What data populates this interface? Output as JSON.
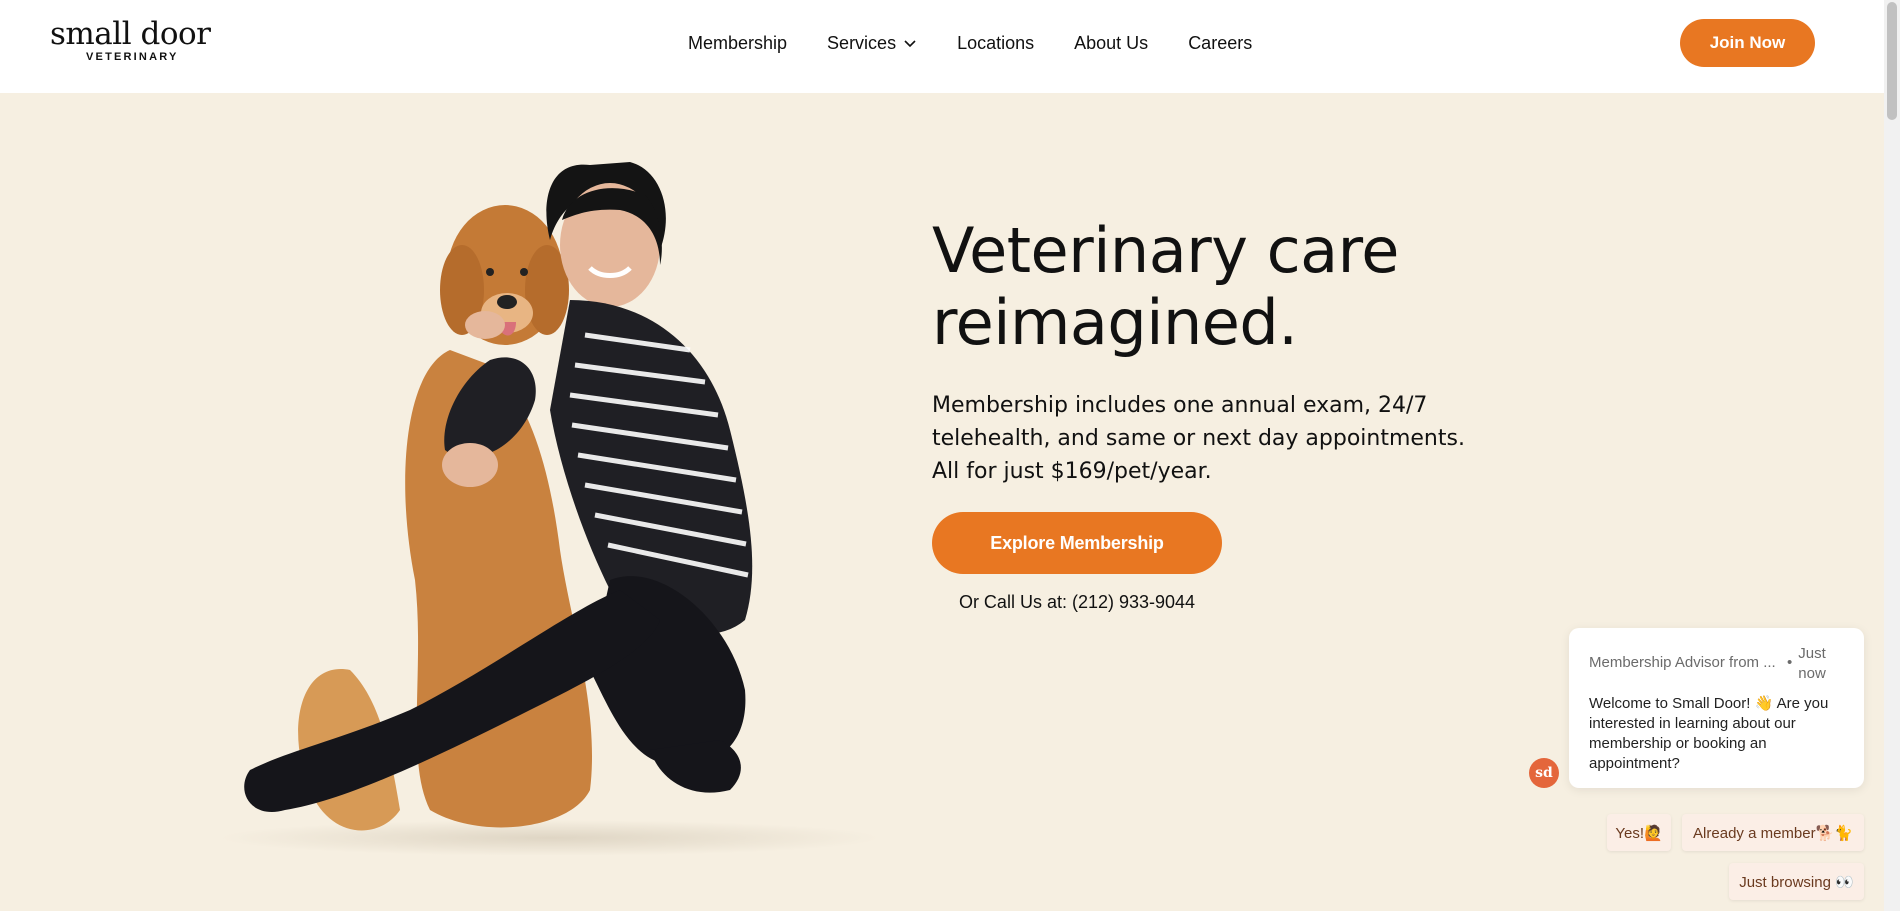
{
  "header": {
    "logo": {
      "word": "small door",
      "sub": "VETERINARY"
    },
    "nav": [
      {
        "label": "Membership"
      },
      {
        "label": "Services",
        "has_dropdown": true
      },
      {
        "label": "Locations"
      },
      {
        "label": "About Us"
      },
      {
        "label": "Careers"
      }
    ],
    "join_label": "Join Now"
  },
  "hero": {
    "headline_line1": "Veterinary care",
    "headline_line2": "reimagined.",
    "subtext": "Membership includes one annual exam, 24/7 telehealth, and same or next day appointments. All for just $169/pet/year.",
    "cta_label": "Explore Membership",
    "call_text": "Or Call Us at: (212) 933-9044",
    "image_alt": "woman hugging golden retriever"
  },
  "chat": {
    "avatar_text": "sd",
    "sender": "Membership Advisor from ...",
    "separator": "•",
    "time": "Just now",
    "message": "Welcome to Small Door! 👋 Are you interested in learning about our membership or booking an appointment?",
    "replies": {
      "yes": "Yes!🙋",
      "member": "Already a member🐕🐈",
      "browse": "Just browsing 👀"
    }
  },
  "colors": {
    "accent": "#e87722",
    "background": "#f6efe1",
    "header": "#ffffff",
    "chat_avatar": "#e4663b",
    "chip": "#fbeee6"
  },
  "icons": {
    "services_dropdown": "chevron-down-icon"
  }
}
